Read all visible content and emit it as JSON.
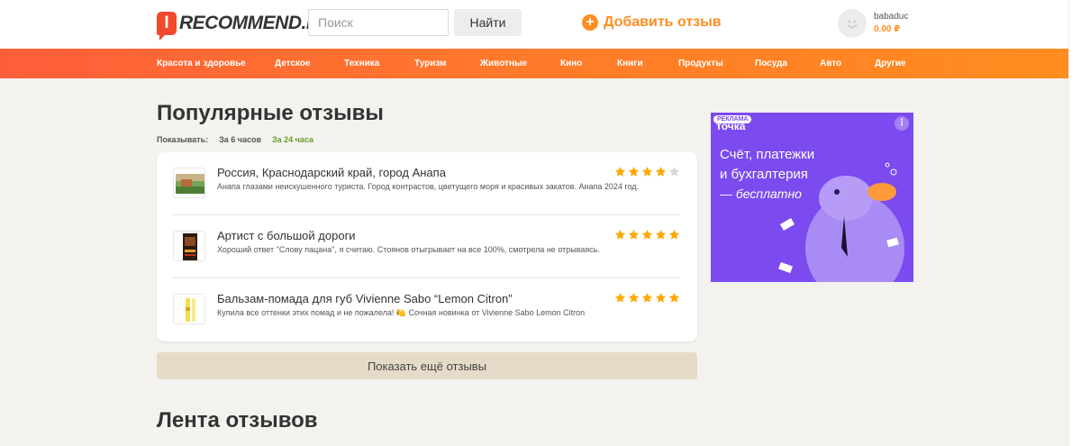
{
  "header": {
    "logo_badge": "I",
    "logo_text": "RECOMMEND.RU",
    "search_placeholder": "Поиск",
    "search_button": "Найти",
    "add_review": "Добавить отзыв",
    "username": "babaduc",
    "balance": "0.00 ₽"
  },
  "nav": {
    "items": [
      "Красота и здоровье",
      "Детское",
      "Техника",
      "Туризм",
      "Животные",
      "Кино",
      "Книги",
      "Продукты",
      "Посуда",
      "Авто",
      "Другие"
    ]
  },
  "popular": {
    "title": "Популярные отзывы",
    "show_label": "Показывать:",
    "option_6h": "За 6 часов",
    "option_24h": "За 24 часа",
    "reviews": [
      {
        "title": "Россия, Краснодарский край, город Анапа",
        "text": "Анапа глазами неискушенного туриста. Город контрастов, цветущего моря и красивых закатов. Анапа 2024 год.",
        "rating": 4,
        "thumb_icon": "landscape-photo"
      },
      {
        "title": "Артист с большой дороги",
        "text": "Хороший ответ \"Слову пацана\", я считаю. Стоянов отыгрывает на все 100%, смотрела не отрываясь.",
        "rating": 5,
        "thumb_icon": "movie-poster"
      },
      {
        "title": "Бальзам-помада для губ Vivienne Sabo “Lemon Citron”",
        "text": "Купила все оттенки этих помад и не пожалела! 🍋 Сочная новинка от Vivienne Sabo Lemon Citron",
        "rating": 5,
        "thumb_icon": "lip-balm-photo"
      }
    ],
    "more_button": "Показать ещё отзывы"
  },
  "feed": {
    "title": "Лента отзывов"
  },
  "ad": {
    "label": "РЕКЛАМА",
    "brand": "точка",
    "menu": "⋮",
    "lines": [
      "Счёт, платежки",
      "и бухгалтерия",
      "— бесплатно"
    ],
    "illustration_icon": "platypus-illustration"
  },
  "colors": {
    "accent": "#ff8d1f",
    "nav_start": "#ff5e3a",
    "star": "#ffa800",
    "star_empty": "#d9d9d9",
    "active_filter": "#6b9a2a",
    "ad_bg": "#7b4bf0"
  }
}
